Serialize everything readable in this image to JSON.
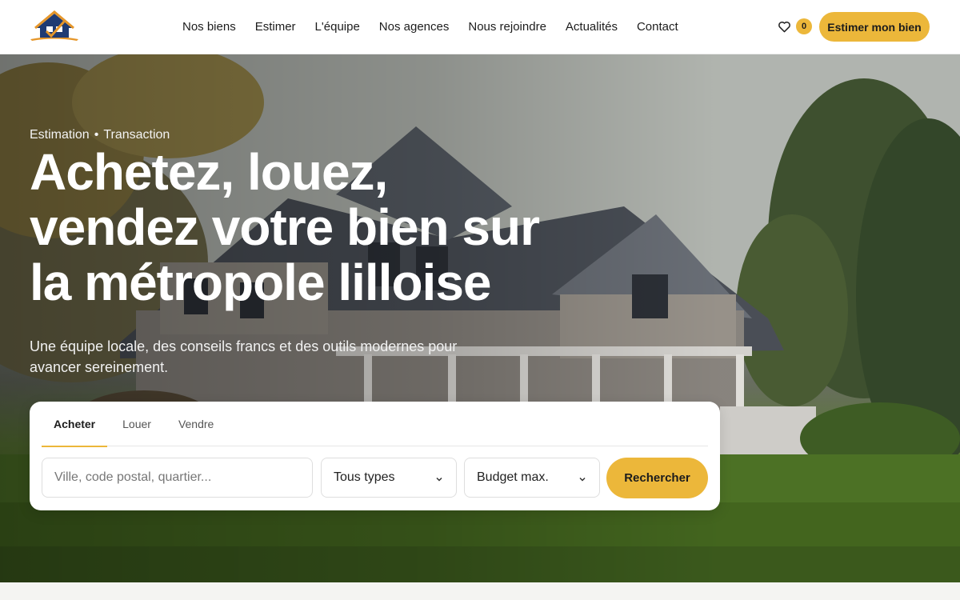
{
  "header": {
    "logo_name": "house-logo",
    "nav": [
      {
        "label": "Nos biens"
      },
      {
        "label": "Estimer"
      },
      {
        "label": "L'équipe"
      },
      {
        "label": "Nos agences"
      },
      {
        "label": "Nous rejoindre"
      },
      {
        "label": "Actualités"
      },
      {
        "label": "Contact"
      }
    ],
    "favorites_icon": "heart-icon",
    "favorites_count": "0",
    "cta_label": "Estimer mon bien"
  },
  "hero": {
    "eyebrow_left": "Estimation",
    "eyebrow_separator": "•",
    "eyebrow_right": "Transaction",
    "headline": "Achetez, louez, vendez votre bien sur la métropole lilloise",
    "subtitle": "Une équipe locale, des conseils francs et des outils modernes pour avancer sereinement."
  },
  "search": {
    "tabs": [
      {
        "label": "Acheter",
        "active": true
      },
      {
        "label": "Louer",
        "active": false
      },
      {
        "label": "Vendre",
        "active": false
      }
    ],
    "location_placeholder": "Ville, code postal, quartier...",
    "type_selected": "Tous types",
    "budget_selected": "Budget max.",
    "submit_label": "Rechercher"
  },
  "colors": {
    "accent": "#ecb73a",
    "text": "#1c1c1c",
    "logo_blue": "#1f3b73",
    "logo_orange": "#e5962a"
  }
}
